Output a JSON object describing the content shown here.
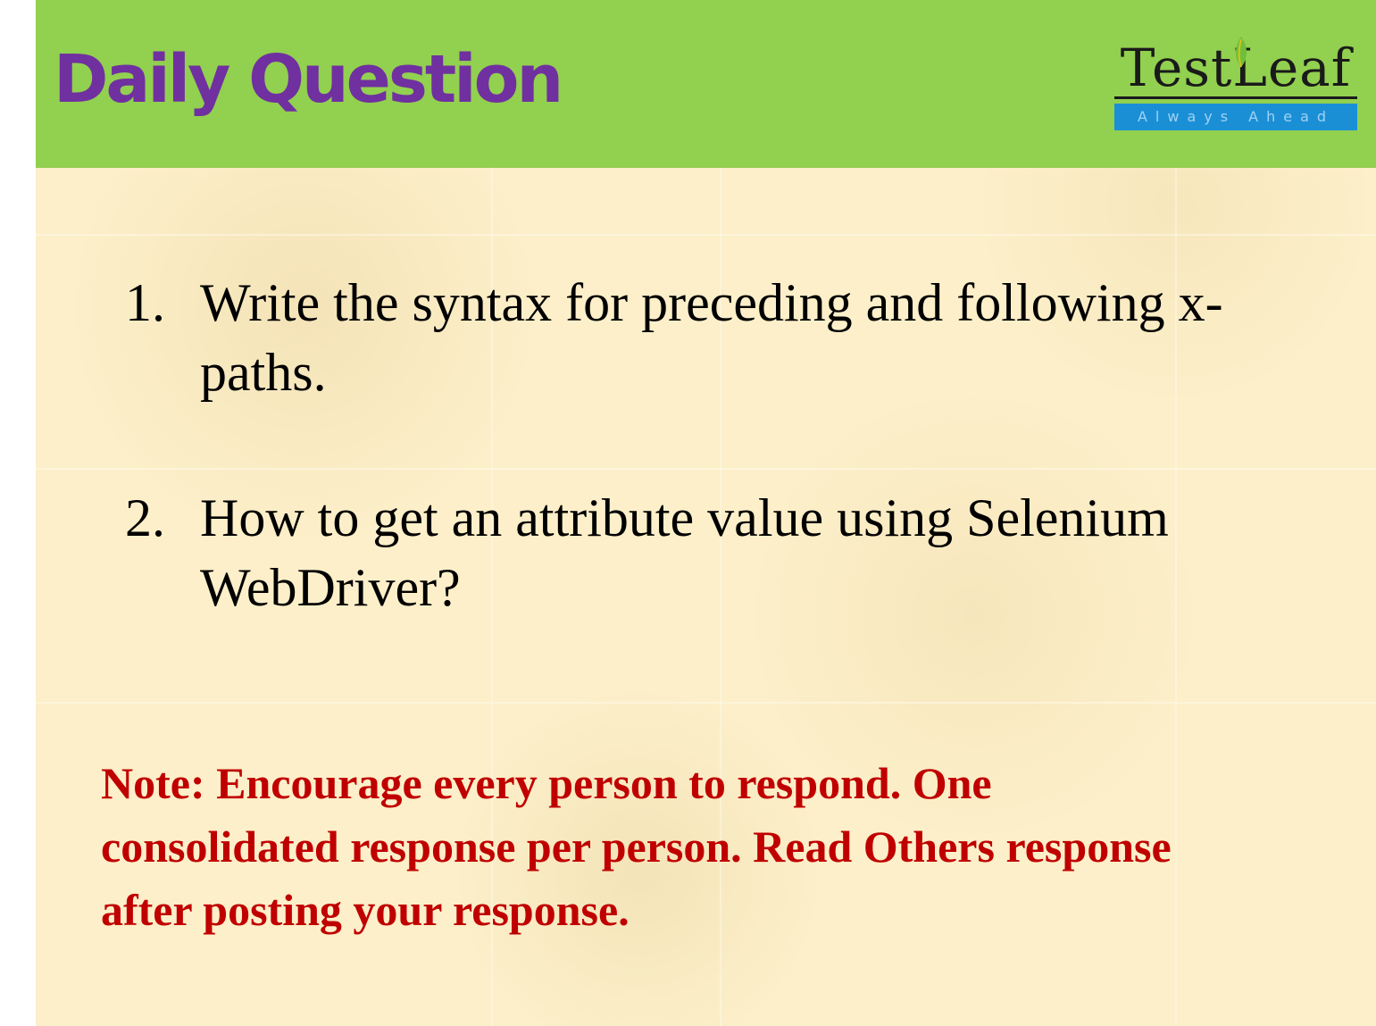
{
  "header": {
    "title": "Daily Question",
    "background_color": "#92d050",
    "title_color": "#7030a0"
  },
  "logo": {
    "name": "TestLeaf",
    "tagline": "Always Ahead"
  },
  "questions": [
    {
      "number": "1.",
      "text": "Write the syntax for preceding and following x-paths."
    },
    {
      "number": "2.",
      "text": "How to get an attribute value using Selenium WebDriver?"
    }
  ],
  "note": {
    "text": "Note: Encourage every person to respond. One consolidated response per person. Read Others response after posting your response.",
    "color": "#c00000"
  }
}
